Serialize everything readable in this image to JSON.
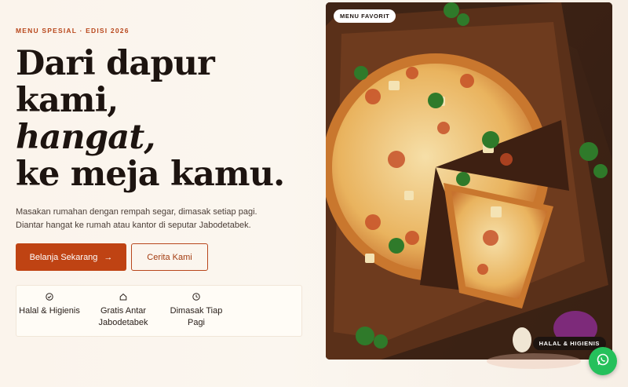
{
  "hero": {
    "eyebrow": "MENU SPESIAL · EDISI 2026",
    "headline": {
      "line1": "Dari dapur",
      "line2": "kami,",
      "line3": "hangat,",
      "line4": "ke meja kamu."
    },
    "subtext": {
      "line1": "Masakan rumahan dengan rempah segar, dimasak setiap pagi.",
      "line2": "Diantar hangat ke rumah atau kantor di seputar Jabodetabek."
    },
    "primary_cta": "Belanja Sekarang",
    "primary_cta_icon": "arrow-right-icon",
    "secondary_cta": "Cerita Kami"
  },
  "features": [
    {
      "icon": "check-circle-icon",
      "label": "Halal & Higienis"
    },
    {
      "icon": "home-icon",
      "label": "Gratis Antar Jabodetabek"
    },
    {
      "icon": "clock-icon",
      "label": "Dimasak Tiap Pagi"
    }
  ],
  "image_card": {
    "top_badge": "MENU FAVORIT",
    "bottom_badge": "HALAL & HIGIENIS",
    "image_subject": "pizza on wooden board"
  },
  "whatsapp": {
    "icon": "whatsapp-icon"
  },
  "colors": {
    "accent": "#bf4313",
    "eyebrow": "#b8471c",
    "headline": "#1d1410",
    "whatsapp": "#25c05b"
  }
}
